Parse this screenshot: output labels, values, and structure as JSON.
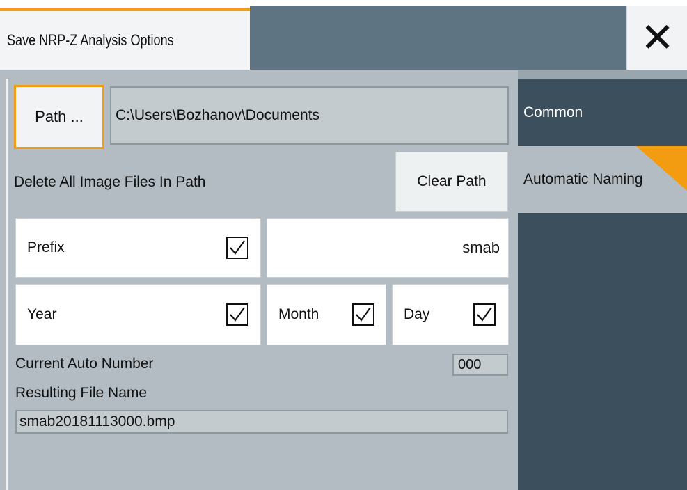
{
  "dialog": {
    "title": "Save NRP-Z Analysis Options",
    "close_symbol": "✕",
    "accent_color": "#f39c12"
  },
  "path": {
    "button_label": "Path ...",
    "value": "C:\\Users\\Bozhanov\\Documents"
  },
  "delete_images": {
    "label": "Delete All Image Files In Path",
    "clear_button_label": "Clear Path"
  },
  "naming": {
    "prefix": {
      "label": "Prefix",
      "checked": true,
      "value": "smab"
    },
    "year": {
      "label": "Year",
      "checked": true
    },
    "month": {
      "label": "Month",
      "checked": true
    },
    "day": {
      "label": "Day",
      "checked": true
    }
  },
  "auto_number": {
    "label": "Current Auto Number",
    "value": "000"
  },
  "result": {
    "label": "Resulting File Name",
    "value": "smab20181113000.bmp"
  },
  "side_tabs": [
    {
      "label": "Common",
      "active": false
    },
    {
      "label": "Automatic Naming",
      "active": true
    }
  ],
  "icons": {
    "close": "close-icon",
    "check": "checkmark-icon"
  }
}
